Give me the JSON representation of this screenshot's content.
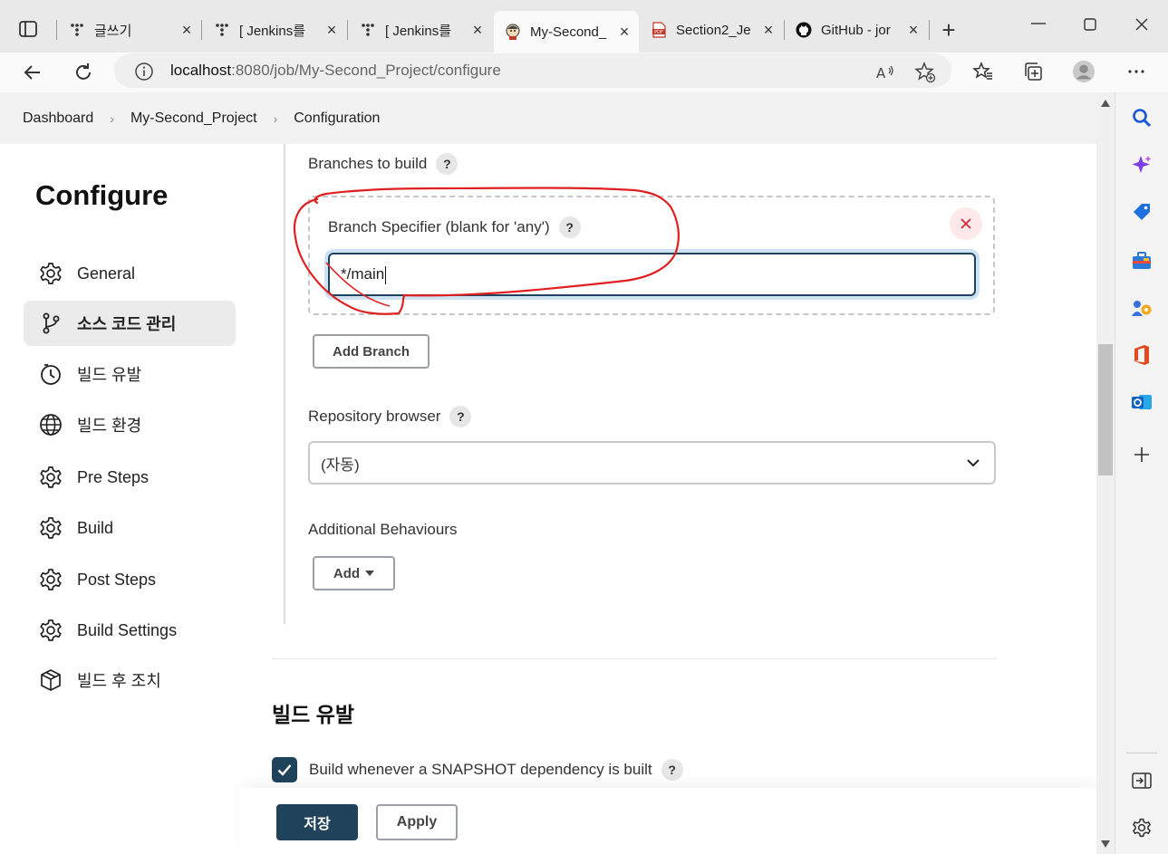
{
  "browser": {
    "tabs": [
      {
        "title": "글쓰기",
        "icon": "tistory-icon"
      },
      {
        "title": "[ Jenkins를 ",
        "icon": "tistory-icon"
      },
      {
        "title": "[ Jenkins를 ",
        "icon": "tistory-icon"
      },
      {
        "title": "My-Second_",
        "icon": "jenkins-icon",
        "active": true
      },
      {
        "title": "Section2_Je",
        "icon": "pdf-icon"
      },
      {
        "title": "GitHub - jor",
        "icon": "github-icon"
      }
    ],
    "close_glyph": "×",
    "url_host": "localhost",
    "url_rest": ":8080/job/My-Second_Project/configure"
  },
  "breadcrumb": {
    "items": [
      "Dashboard",
      "My-Second_Project",
      "Configuration"
    ],
    "separator": "›"
  },
  "sidebar": {
    "title": "Configure",
    "items": [
      {
        "label": "General",
        "icon": "gear-icon"
      },
      {
        "label": "소스 코드 관리",
        "icon": "branch-icon",
        "active": true
      },
      {
        "label": "빌드 유발",
        "icon": "timer-icon"
      },
      {
        "label": "빌드 환경",
        "icon": "globe-icon"
      },
      {
        "label": "Pre Steps",
        "icon": "gear-icon"
      },
      {
        "label": "Build",
        "icon": "gear-icon"
      },
      {
        "label": "Post Steps",
        "icon": "gear-icon"
      },
      {
        "label": "Build Settings",
        "icon": "gear-icon"
      },
      {
        "label": "빌드 후 조치",
        "icon": "package-icon"
      }
    ]
  },
  "scm": {
    "branches_label": "Branches to build",
    "branch_specifier_label": "Branch Specifier (blank for 'any')",
    "branch_specifier_value": "*/main",
    "add_branch": "Add Branch",
    "repo_browser_label": "Repository browser",
    "repo_browser_value": "(자동)",
    "additional_behaviours_label": "Additional Behaviours",
    "add_label": "Add"
  },
  "triggers": {
    "heading": "빌드 유발",
    "snapshot_label": "Build whenever a SNAPSHOT dependency is built",
    "snapshot_checked": true
  },
  "footer": {
    "save": "저장",
    "apply": "Apply"
  },
  "help_glyph": "?",
  "colors": {
    "primary": "#20435c",
    "annotation": "#e02020",
    "danger": "#d6283d"
  }
}
